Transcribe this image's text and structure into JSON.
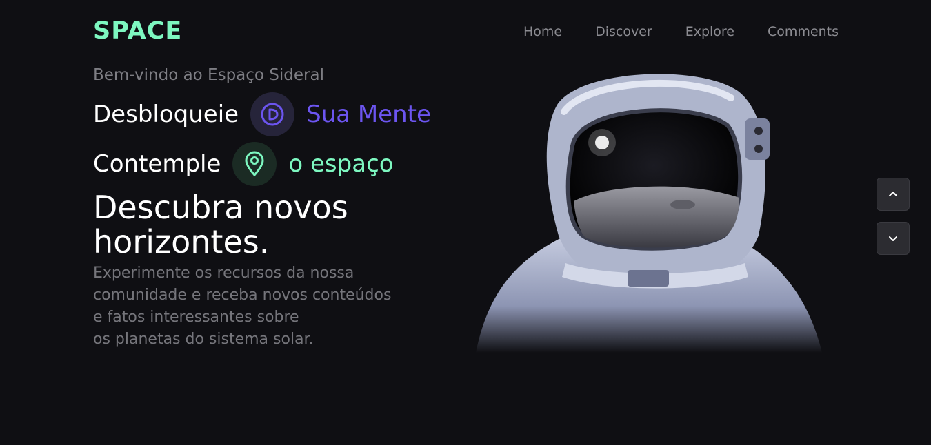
{
  "header": {
    "logo": "SPACE",
    "nav": [
      {
        "label": "Home"
      },
      {
        "label": "Discover"
      },
      {
        "label": "Explore"
      },
      {
        "label": "Comments"
      }
    ]
  },
  "hero": {
    "welcome": "Bem-vindo ao Espaço Sideral",
    "line1": {
      "word": "Desbloqueie",
      "icon": "brain-circle-icon",
      "accent": "Sua Mente"
    },
    "line2": {
      "word": "Contemple",
      "icon": "location-pin-icon",
      "accent": "o espaço"
    },
    "headline": "Descubra novos horizontes.",
    "description": "Experimente os recursos da nossa\ncomunidade e receba novos conteúdos\ne fatos interessantes sobre\nos planetas do sistema solar."
  },
  "scroll": {
    "up_icon": "chevron-up-icon",
    "down_icon": "chevron-down-icon"
  },
  "colors": {
    "background": "#0f0f13",
    "accent_green": "#7df7c0",
    "accent_purple": "#6c55f0",
    "muted_text": "#75757b"
  }
}
